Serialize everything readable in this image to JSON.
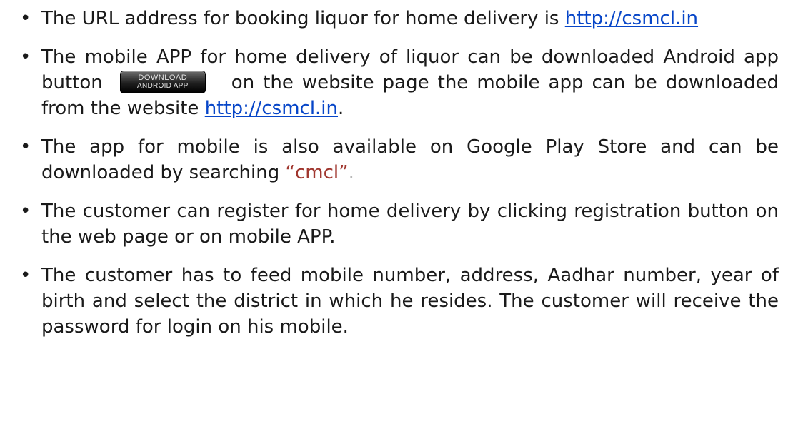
{
  "bullets": [
    {
      "text": "The URL address for booking liquor for home delivery is ",
      "link": "http://csmcl.in"
    },
    {
      "text_a": "The mobile APP for home delivery of liquor can be downloaded Android app button",
      "button": {
        "line1": "DOWNLOAD",
        "line2": "ANDROID APP"
      },
      "text_b": "on the website page the mobile app can be downloaded from the website ",
      "link": "http://csmcl.in",
      "end": "."
    },
    {
      "text": "The app for mobile is also available on Google Play Store and can be downloaded by searching ",
      "search_term": "“cmcl”",
      "end": "."
    },
    {
      "text": "The customer can register for home delivery by clicking registration button on the web page or on mobile APP."
    },
    {
      "text": " The customer has to feed mobile number, address, Aadhar number, year of birth and select the district in which he resides.  The customer will receive the password for login on his mobile."
    }
  ],
  "colors": {
    "link": "#0645c8",
    "search_term": "#a0362e",
    "text": "#1a1a1a"
  },
  "bullet_glyph": "•"
}
